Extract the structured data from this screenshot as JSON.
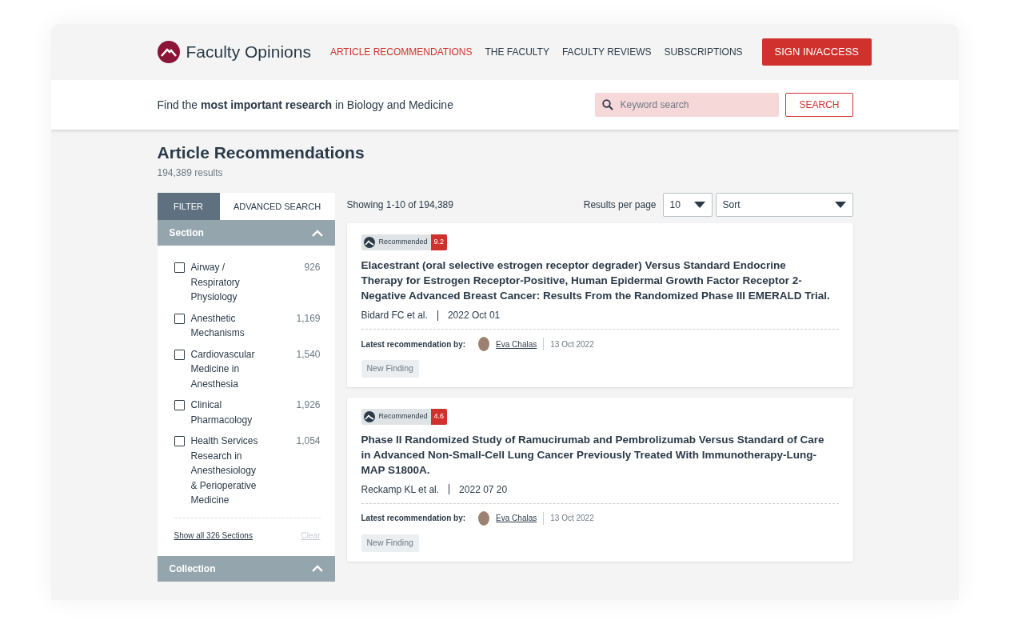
{
  "brand": {
    "name": "Faculty Opinions"
  },
  "nav": [
    {
      "label": "ARTICLE RECOMMENDATIONS",
      "selected": true
    },
    {
      "label": "THE FACULTY",
      "selected": false
    },
    {
      "label": "FACULTY REVIEWS",
      "selected": false
    },
    {
      "label": "SUBSCRIPTIONS",
      "selected": false
    }
  ],
  "sign_in": "SIGN IN/ACCESS",
  "tagline": "Find the **most important research** in Biology and Medicine",
  "search": {
    "placeholder": "Keyword search",
    "button": "SEARCH"
  },
  "page": {
    "title": "Article Recommendations",
    "count": "194,389 results"
  },
  "filter_tabs": [
    {
      "label": "FILTER",
      "selected": true
    },
    {
      "label": "ADVANCED SEARCH",
      "selected": false
    }
  ],
  "filter_groups": [
    {
      "title": "Section",
      "expanded": true,
      "items": [
        {
          "label": "Airway / Respiratory Physiology",
          "count": "926",
          "checked": false
        },
        {
          "label": "Anesthetic Mechanisms",
          "count": "1,169",
          "checked": false
        },
        {
          "label": "Cardiovascular Medicine in Anesthesia",
          "count": "1,540",
          "checked": false
        },
        {
          "label": "Clinical Pharmacology",
          "count": "1,926",
          "checked": false
        },
        {
          "label": "Health Services Research in Anesthesiology & Perioperative Medicine",
          "count": "1,054",
          "checked": false
        }
      ],
      "show_all": "Show all 326 Sections",
      "clear": {
        "label": "Clear",
        "disabled": true
      }
    },
    {
      "title": "Collection",
      "expanded": true
    }
  ],
  "results": {
    "showing": "Showing 1-10 of 194,389",
    "per_page_label": "Results per page",
    "per_page": "10",
    "sort": "Sort"
  },
  "articles": [
    {
      "badge": "Recommended",
      "score": "9.2",
      "title": "Elacestrant (oral selective estrogen receptor degrader) Versus Standard Endocrine Therapy for Estrogen Receptor-Positive, Human Epidermal Growth Factor Receptor 2-Negative Advanced Breast Cancer: Results From the Randomized Phase III EMERALD Trial.",
      "authors": "Bidard FC et al.",
      "date": "2022 Oct 01",
      "rec_label": "Latest recommendation by:",
      "recommender": "Eva Chalas",
      "rec_date": "13 Oct 2022",
      "tag": "New Finding"
    },
    {
      "badge": "Recommended",
      "score": "4.6",
      "title": "Phase II Randomized Study of Ramucirumab and Pembrolizumab Versus Standard of Care in Advanced Non-Small-Cell Lung Cancer Previously Treated With Immunotherapy-Lung-MAP S1800A.",
      "authors": "Reckamp KL et al.",
      "date": "2022 07 20",
      "rec_label": "Latest recommendation by:",
      "recommender": "Eva Chalas",
      "rec_date": "13 Oct 2022",
      "tag": "New Finding"
    }
  ]
}
